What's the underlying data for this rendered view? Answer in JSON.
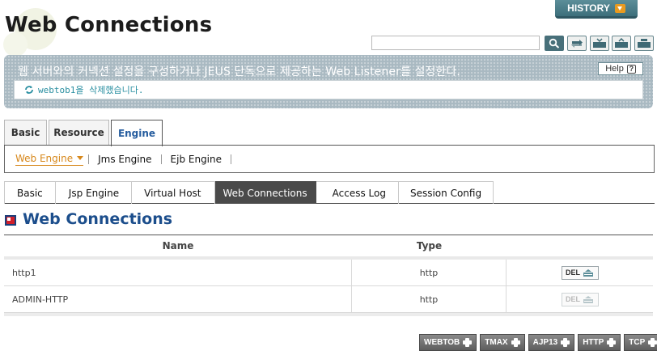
{
  "header": {
    "title": "Web Connections",
    "history_label": "HISTORY",
    "search_placeholder": "",
    "toolbar": [
      "search-icon",
      "refresh-icon",
      "xml-export-icon",
      "xml-import-icon",
      "xml-view-icon"
    ]
  },
  "description": {
    "text": "웹 서버와의 커넥션 설정을 구성하거나 JEUS 단독으로 제공하는 Web Listener를 설정한다.",
    "help_label": "Help",
    "status_message": "webtob1을 삭제했습니다."
  },
  "top_tabs": [
    {
      "label": "Basic",
      "active": false
    },
    {
      "label": "Resource",
      "active": false
    },
    {
      "label": "Engine",
      "active": true
    }
  ],
  "engine_nav": [
    {
      "label": "Web Engine",
      "active": true
    },
    {
      "label": "Jms Engine",
      "active": false
    },
    {
      "label": "Ejb Engine",
      "active": false
    }
  ],
  "sub_tabs": [
    {
      "label": "Basic",
      "active": false
    },
    {
      "label": "Jsp Engine",
      "active": false
    },
    {
      "label": "Virtual Host",
      "active": false
    },
    {
      "label": "Web Connections",
      "active": true
    },
    {
      "label": "Access Log",
      "active": false
    },
    {
      "label": "Session Config",
      "active": false
    }
  ],
  "section": {
    "title": "Web Connections"
  },
  "table": {
    "columns": [
      "Name",
      "Type",
      ""
    ],
    "rows": [
      {
        "name": "http1",
        "type": "http",
        "action": "DEL",
        "action_enabled": true
      },
      {
        "name": "ADMIN-HTTP",
        "type": "http",
        "action": "DEL",
        "action_enabled": false
      }
    ]
  },
  "add_buttons": [
    "WEBTOB",
    "TMAX",
    "AJP13",
    "HTTP",
    "TCP"
  ],
  "colors": {
    "accent": "#255c9e",
    "active_nav": "#d7881c",
    "status_text": "#2a8fa1"
  }
}
